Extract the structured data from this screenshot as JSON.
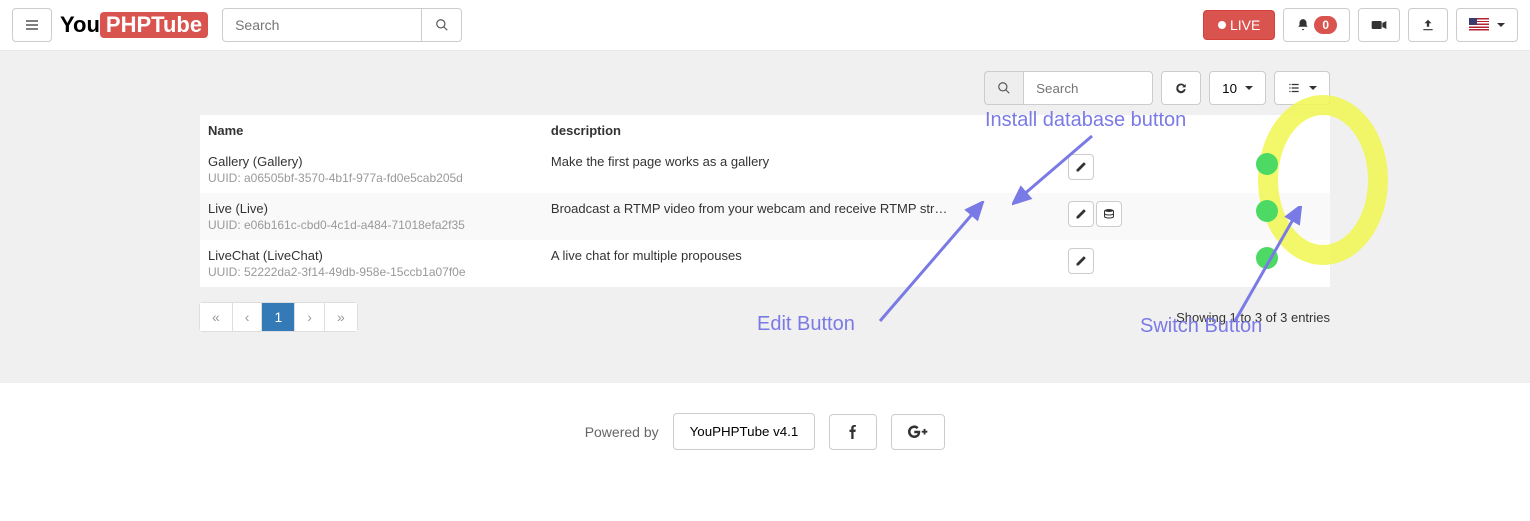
{
  "header": {
    "logo_you": "You",
    "logo_phptube": "PHPTube",
    "search_placeholder": "Search",
    "live_label": "LIVE",
    "notification_count": "0"
  },
  "toolbar": {
    "search_placeholder": "Search",
    "page_size": "10"
  },
  "table": {
    "headers": {
      "name": "Name",
      "description": "description"
    },
    "rows": [
      {
        "name": "Gallery (Gallery)",
        "uuid_label": "UUID: a06505bf-3570-4b1f-977a-fd0e5cab205d",
        "description": "Make the first page works as a gallery",
        "has_db": false
      },
      {
        "name": "Live (Live)",
        "uuid_label": "UUID: e06b161c-cbd0-4c1d-a484-71018efa2f35",
        "description": "Broadcast a RTMP video from your webcam and receive RTMP str…",
        "has_db": true
      },
      {
        "name": "LiveChat (LiveChat)",
        "uuid_label": "UUID: 52222da2-3f14-49db-958e-15ccb1a07f0e",
        "description": "A live chat for multiple propouses",
        "has_db": false
      }
    ]
  },
  "pagination": {
    "first": "«",
    "prev": "‹",
    "page1": "1",
    "next": "›",
    "last": "»",
    "info": "Showing 1 to 3 of 3 entries"
  },
  "annotations": {
    "install_db": "Install database button",
    "edit": "Edit Button",
    "switch": "Switch Button"
  },
  "footer": {
    "powered_by": "Powered by",
    "version": "YouPHPTube v4.1"
  }
}
